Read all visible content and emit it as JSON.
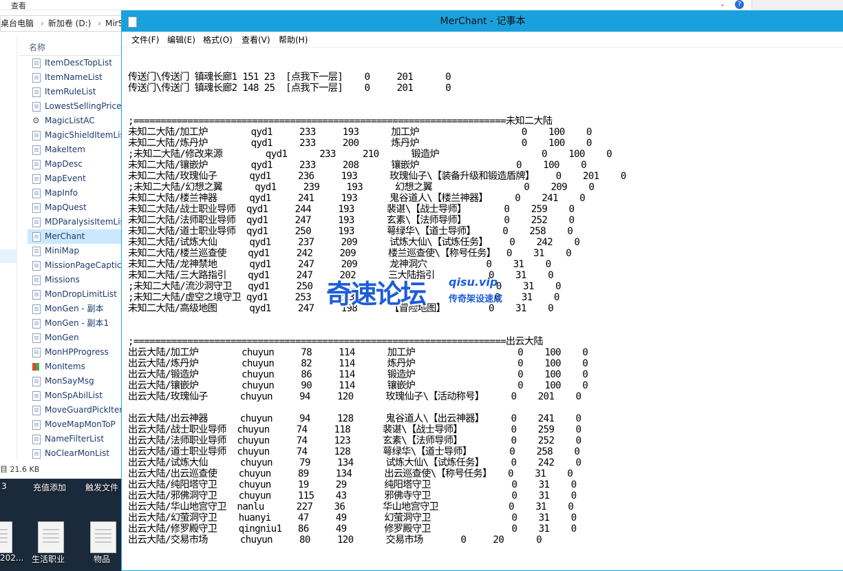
{
  "explorer": {
    "menu_view": "查看",
    "breadcrumb": [
      "桌台电脑",
      "新加卷 (D:)",
      "MirS"
    ],
    "column_name": "名称",
    "files": [
      "ItemDescTopList",
      "ItemNameList",
      "ItemRuleList",
      "LowestSellingPrice",
      "MagicListAC",
      "MagicShieldItemLis",
      "MakeItem",
      "MapDesc",
      "MapEvent",
      "MapInfo",
      "MapQuest",
      "MDParalysisItemLis",
      "MerChant",
      "MiniMap",
      "MissionPageCaptic",
      "Missions",
      "MonDropLimitList",
      "MonGen - 副本",
      "MonGen - 副本1",
      "MonGen",
      "MonHPProgress",
      "MonItems",
      "MonSayMsg",
      "MonSpAbilList",
      "MoveGuardPickIter",
      "MoveMapMonToP",
      "NameFilterList",
      "NoClearMonList"
    ],
    "selected_file": "MerChant",
    "status": "目 21.6 KB"
  },
  "desktop": {
    "labels": [
      "3",
      "充值添加",
      "触发文件"
    ],
    "icons": [
      "202...",
      "生活职业",
      "物品"
    ]
  },
  "notepad": {
    "title": "MerChant - 记事本",
    "menu": [
      "文件(F)",
      "编辑(E)",
      "格式(O)",
      "查看(V)",
      "帮助(H)"
    ],
    "lines": [
      "",
      "",
      "传送门\\传送门 镇魂长廊1 151 23  [点我下一层]    0     201      0",
      "传送门\\传送门 镇魂长廊2 148 25  [点我下一层]    0     201      0",
      "",
      "",
      ";=====================================================================未知二大陆",
      "未知二大陆/加工炉        qyd1     233     193      加工炉                   0    100    0",
      "未知二大陆/炼丹炉        qyd1     233     200      炼丹炉                   0    100    0",
      ";未知二大陆/修改来源        qyd1      233     210      锻造炉                   0    100    0",
      "未知二大陆/镶嵌炉        qyd1     233     208      镶嵌炉                  0    100    0",
      "未知二大陆/玫瑰仙子      qyd1     236     193      玫瑰仙子\\【装备升级和锻造盾牌】    0    201    0",
      ";未知二大陆/幻想之翼      qyd1     239     193      幻想之翼                 0    209    0",
      "未知二大陆/楼兰神器      qyd1     241     193      鬼谷道人\\【楼兰神器】     0    241    0",
      "未知二大陆/战士职业导师  qyd1     244     193      裴谌\\【战士导师】       0    259    0",
      "未知二大陆/法师职业导师  qyd1     247     193      玄素\\【法师导师】       0    252    0",
      "未知二大陆/道士职业导师  qyd1     250     193      萼绿华\\【道士导师】     0    258    0",
      "未知二大陆/试炼大仙      qyd1     237     209      试炼大仙\\【试炼任务】    0    242    0",
      "未知二大陆/楼兰巡查使    qyd1     242     209      楼兰巡查使\\【称号任务】  0    31    0",
      "未知二大陆/龙神禁地      qyd1     247     209      龙神洞穴           0    31    0",
      "未知二大陆/三大路指引    qyd1     247     202      三大陆指引          0    31    0",
      ";未知二大陆/流沙洞守卫   qyd1     250     203                          0    31    0",
      ";未知二大陆/虚空之境守卫 qyd1     253     203                          0    31    0",
      "未知二大陆/高级地图      qyd1     247     198      【冒险地图】        0    31    0",
      "",
      "",
      ";=====================================================================出云大陆",
      "出云大陆/加工炉        chuyun     78     114      加工炉                   0    100    0",
      "出云大陆/炼丹炉        chuyun     82     114      炼丹炉                   0    100    0",
      "出云大陆/锻造炉        chuyun     86     114      锻造炉                   0    100    0",
      "出云大陆/镶嵌炉        chuyun     90     114      镶嵌炉                   0    100    0",
      "出云大陆/玫瑰仙子      chuyun     94     120      玫瑰仙子\\【活动称号】     0    201    0",
      "",
      "出云大陆/出云神器      chuyun     94     128      鬼谷道人\\【出云神器】     0    241    0",
      "出云大陆/战士职业导师  chuyun     74     118      裴谌\\【战士导师】         0    259    0",
      "出云大陆/法师职业导师  chuyun     74     123      玄素\\【法师导师】         0    252    0",
      "出云大陆/道士职业导师  chuyun     74     128      萼绿华\\【道士导师】       0    258    0",
      "出云大陆/试炼大仙      chuyun     79     134      试炼大仙\\【试炼任务】     0    242    0",
      "出云大陆/出云巡查使    chuyun     89     134      出云巡查使\\【称号任务】   0    31    0",
      "出云大陆/纯阳塔守卫    chuyun     19     29       纯阳塔守卫               0    31    0",
      "出云大陆/邪佛洞守卫    chuyun     115    43       邪佛寺守卫               0    31    0",
      "出云大陆/华山地宫守卫  nanlu      227    36       华山地宫守卫             0    31    0",
      "出云大陆/幻萤洞守卫    huanyi     47     49       幻萤洞守卫               0    31    0",
      "出云大陆/修罗殿守卫    qingniu1   86     49       修罗殿守卫               0    31    0",
      "出云大陆/交易市场      chuyun     80     120      交易市场       0     20      0"
    ]
  },
  "watermark": {
    "brand": "奇速论坛",
    "url": "qisu.vip",
    "slogan": "传奇架设速成"
  }
}
